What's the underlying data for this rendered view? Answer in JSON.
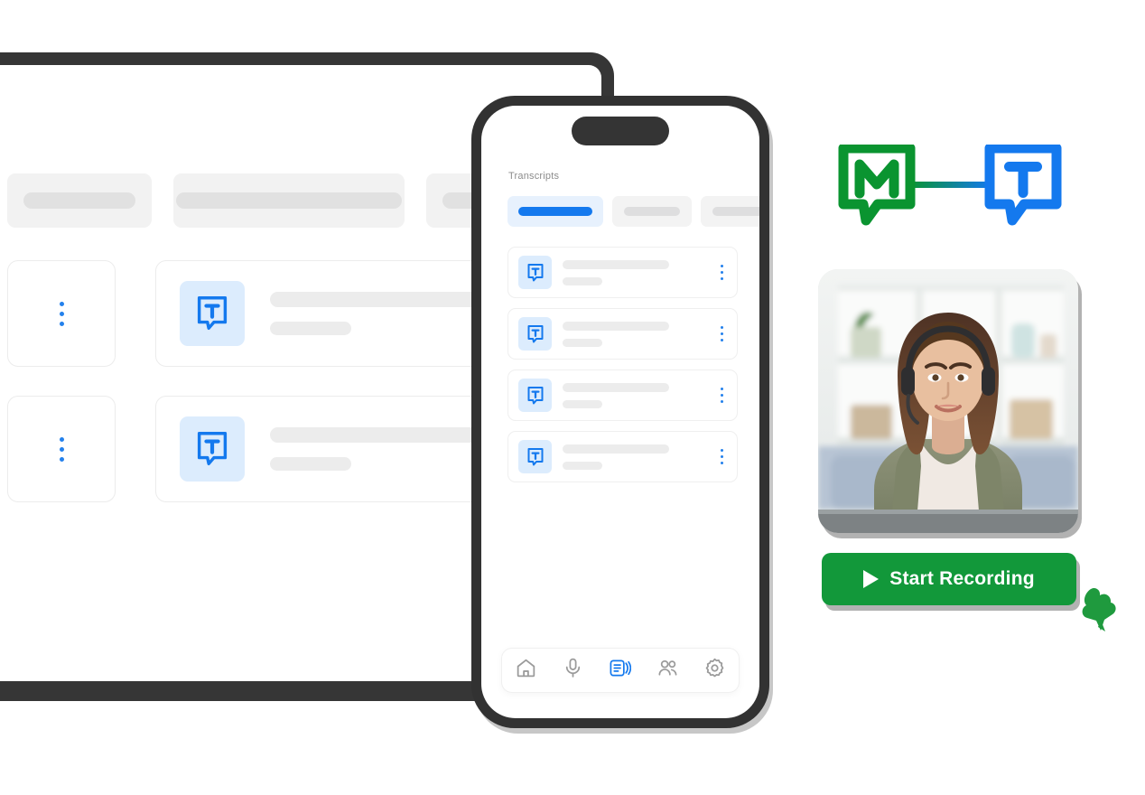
{
  "colors": {
    "accent_blue": "#1479ee",
    "accent_blue_dot": "#2481ec",
    "tile_blue_bg": "#dcecfd",
    "brand_green": "#0a9430",
    "button_green": "#12983a",
    "bezel_dark": "#323232",
    "skeleton_gray": "#ececec",
    "tab_gray": "#f2f2f2",
    "muted_text": "#8c8c8c"
  },
  "desktop": {
    "name": "desktop-app-window",
    "tabs": [
      {
        "id": "tab-1",
        "variant": "small",
        "label": ""
      },
      {
        "id": "tab-2",
        "variant": "large",
        "label": ""
      },
      {
        "id": "tab-3",
        "variant": "small",
        "label": ""
      }
    ],
    "rows": [
      {
        "id": "row-1",
        "icon": "transcript-bubble-icon",
        "title": "",
        "subtitle": "",
        "menu": "more-options"
      },
      {
        "id": "row-2",
        "icon": "transcript-bubble-icon",
        "title": "",
        "subtitle": "",
        "menu": "more-options"
      }
    ],
    "nav": [
      {
        "id": "mic",
        "icon": "microphone-icon",
        "active": false
      },
      {
        "id": "transcripts",
        "icon": "transcript-document-icon",
        "active": true
      },
      {
        "id": "people",
        "icon": "people-icon",
        "active": false
      },
      {
        "id": "settings",
        "icon": "gear-icon",
        "active": false
      }
    ]
  },
  "phone": {
    "name": "mobile-app-mockup",
    "title": "Transcripts",
    "tabs": [
      {
        "id": "phone-tab-1",
        "active": true,
        "label": ""
      },
      {
        "id": "phone-tab-2",
        "active": false,
        "label": ""
      },
      {
        "id": "phone-tab-3",
        "active": false,
        "label": ""
      }
    ],
    "list": [
      {
        "id": "item-1",
        "icon": "transcript-bubble-icon",
        "title": "",
        "subtitle": "",
        "menu": "more-options"
      },
      {
        "id": "item-2",
        "icon": "transcript-bubble-icon",
        "title": "",
        "subtitle": "",
        "menu": "more-options"
      },
      {
        "id": "item-3",
        "icon": "transcript-bubble-icon",
        "title": "",
        "subtitle": "",
        "menu": "more-options"
      },
      {
        "id": "item-4",
        "icon": "transcript-bubble-icon",
        "title": "",
        "subtitle": "",
        "menu": "more-options"
      }
    ],
    "nav": [
      {
        "id": "home",
        "icon": "home-icon",
        "active": false
      },
      {
        "id": "mic",
        "icon": "microphone-icon",
        "active": false
      },
      {
        "id": "transcripts",
        "icon": "transcript-document-icon",
        "active": true
      },
      {
        "id": "people",
        "icon": "people-icon",
        "active": false
      },
      {
        "id": "settings",
        "icon": "gear-icon",
        "active": false
      }
    ]
  },
  "integration": {
    "name": "integration-logos",
    "left_logo": {
      "letter": "M",
      "icon": "meeting-bubble-m-icon",
      "color": "#0a9430"
    },
    "right_logo": {
      "letter": "T",
      "icon": "transcript-bubble-t-icon",
      "color": "#1479ee"
    },
    "connector": "gradient-link"
  },
  "video": {
    "name": "video-call-preview",
    "alt": "Woman wearing a headset on a video call in front of a blurred white shelving unit"
  },
  "record": {
    "name": "start-recording-button",
    "label": "Start Recording",
    "icon": "play-icon"
  }
}
